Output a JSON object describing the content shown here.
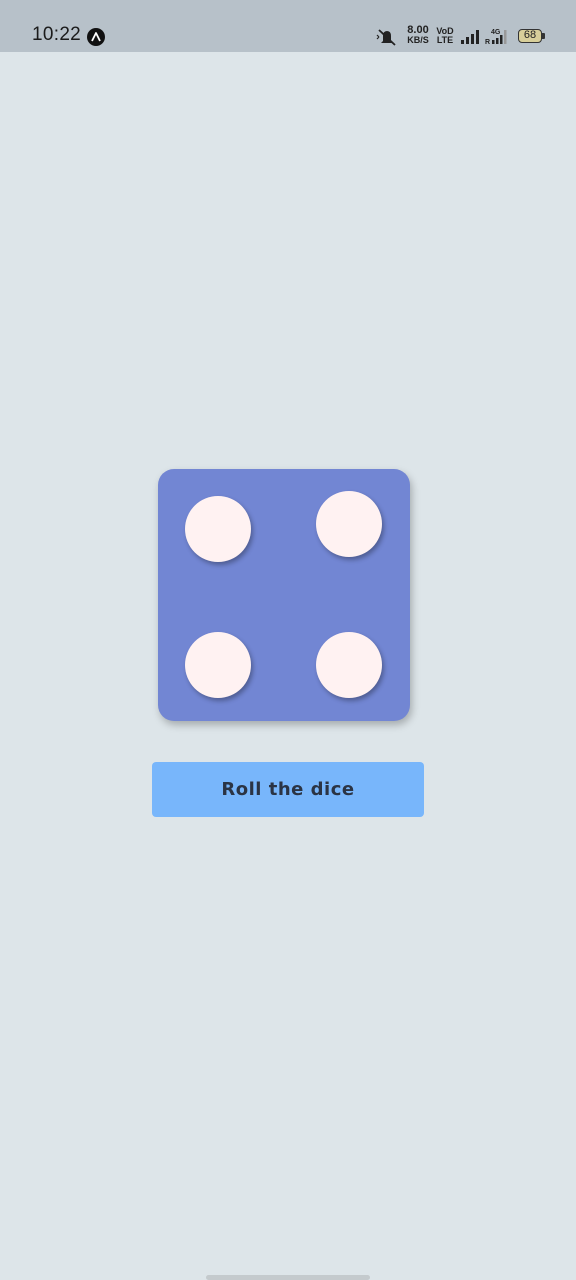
{
  "status_bar": {
    "time": "10:22",
    "net_speed_value": "8.00",
    "net_speed_unit": "KB/S",
    "volte_top": "VoD",
    "volte_bottom": "LTE",
    "network_type": "4G",
    "roaming": "R",
    "battery_level": "68",
    "icons": [
      "app-notification-icon",
      "mute-icon",
      "signal-icon",
      "signal-4g-icon",
      "battery-icon"
    ]
  },
  "dice": {
    "value": 4,
    "color": "#7286d3",
    "pip_color": "#fff2f2"
  },
  "roll_button": {
    "label": "Roll the dice",
    "color": "#78b6fb"
  },
  "background_color": "#dde5e9"
}
